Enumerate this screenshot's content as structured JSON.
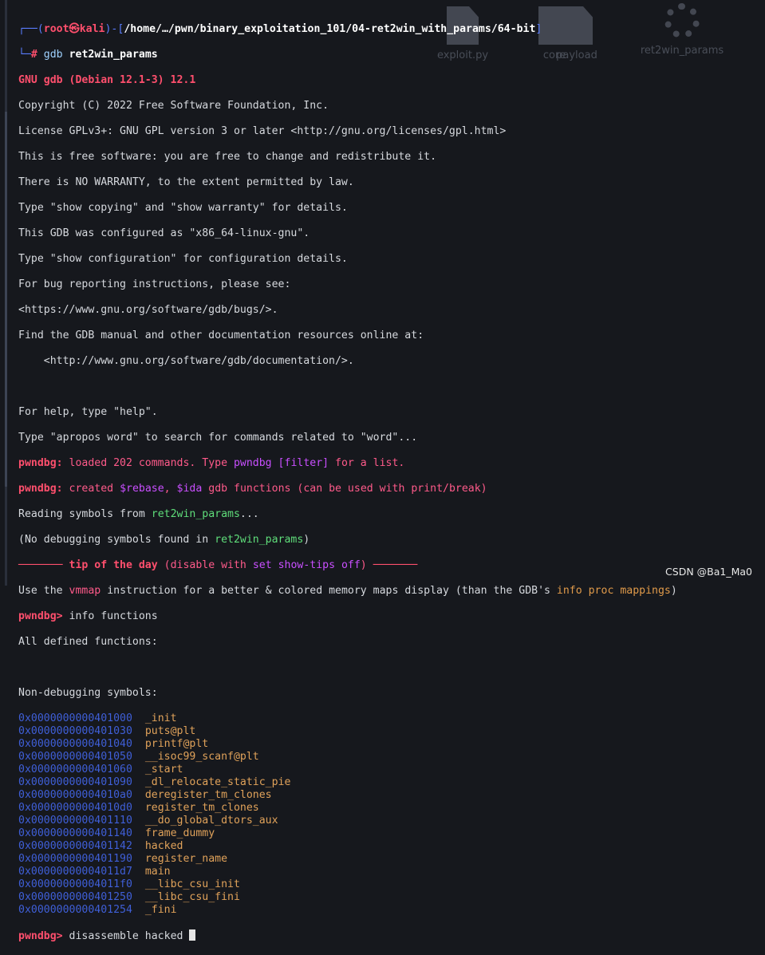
{
  "desktop_icons": [
    {
      "label": "core",
      "icon": "file-icon"
    },
    {
      "label": "exploit.py",
      "icon": "file-icon"
    },
    {
      "label": "payload",
      "icon": "file-icon"
    },
    {
      "label": "ret2win_params",
      "icon": "gear-icon"
    }
  ],
  "prompt": {
    "user": "root",
    "symbol": "㉿",
    "host": "kali",
    "path": "/home/…/pwn/binary_exploitation_101/04-ret2win_with_params/64-bit",
    "hash": "#",
    "cmd": "gdb",
    "arg": "ret2win_params"
  },
  "gdb": {
    "banner": "GNU gdb (Debian 12.1-3) 12.1",
    "lines": [
      "Copyright (C) 2022 Free Software Foundation, Inc.",
      "License GPLv3+: GNU GPL version 3 or later <http://gnu.org/licenses/gpl.html>",
      "This is free software: you are free to change and redistribute it.",
      "There is NO WARRANTY, to the extent permitted by law.",
      "Type \"show copying\" and \"show warranty\" for details.",
      "This GDB was configured as \"x86_64-linux-gnu\".",
      "Type \"show configuration\" for configuration details.",
      "For bug reporting instructions, please see:",
      "<https://www.gnu.org/software/gdb/bugs/>.",
      "Find the GDB manual and other documentation resources online at:",
      "    <http://www.gnu.org/software/gdb/documentation/>.",
      "",
      "For help, type \"help\".",
      "Type \"apropos word\" to search for commands related to \"word\"..."
    ]
  },
  "pwndbg": {
    "prefix": "pwndbg:",
    "loaded_a": "loaded 202 commands. Type",
    "loaded_b": "pwndbg [filter]",
    "loaded_c": "for a list.",
    "created_a": "created",
    "created_b": "$rebase",
    "created_c": ",",
    "created_d": "$ida",
    "created_e": "gdb functions (can be used with print/break)",
    "reading_a": "Reading symbols from",
    "reading_b": "ret2win_params",
    "reading_c": "...",
    "nodebug_a": "(No debugging symbols found in",
    "nodebug_b": "ret2win_params",
    "nodebug_c": ")",
    "tip_dash_left": "───────",
    "tip_title": "tip of the day",
    "tip_paren_a": "(disable with",
    "tip_paren_b": "set show-tips off",
    "tip_paren_c": ")",
    "tip_dash_right": "───────",
    "tip_a": "Use the",
    "tip_b": "vmmap",
    "tip_c": "instruction for a better & colored memory maps display (than the GDB's",
    "tip_d": "info proc mappings",
    "tip_e": ")"
  },
  "session": {
    "prompt_label": "pwndbg>",
    "command1": "info functions",
    "all_defined": "All defined functions:",
    "nondebug": "Non-debugging symbols:",
    "symbols": [
      {
        "addr": "0x0000000000401000",
        "name": "_init"
      },
      {
        "addr": "0x0000000000401030",
        "name": "puts@plt"
      },
      {
        "addr": "0x0000000000401040",
        "name": "printf@plt"
      },
      {
        "addr": "0x0000000000401050",
        "name": "__isoc99_scanf@plt"
      },
      {
        "addr": "0x0000000000401060",
        "name": "_start"
      },
      {
        "addr": "0x0000000000401090",
        "name": "_dl_relocate_static_pie"
      },
      {
        "addr": "0x00000000004010a0",
        "name": "deregister_tm_clones"
      },
      {
        "addr": "0x00000000004010d0",
        "name": "register_tm_clones"
      },
      {
        "addr": "0x0000000000401110",
        "name": "__do_global_dtors_aux"
      },
      {
        "addr": "0x0000000000401140",
        "name": "frame_dummy"
      },
      {
        "addr": "0x0000000000401142",
        "name": "hacked"
      },
      {
        "addr": "0x0000000000401190",
        "name": "register_name"
      },
      {
        "addr": "0x00000000004011d7",
        "name": "main"
      },
      {
        "addr": "0x00000000004011f0",
        "name": "__libc_csu_init"
      },
      {
        "addr": "0x0000000000401250",
        "name": "__libc_csu_fini"
      },
      {
        "addr": "0x0000000000401254",
        "name": "_fini"
      }
    ],
    "command2": "disassemble hacked"
  },
  "watermark": "CSDN @Ba1_Ma0"
}
